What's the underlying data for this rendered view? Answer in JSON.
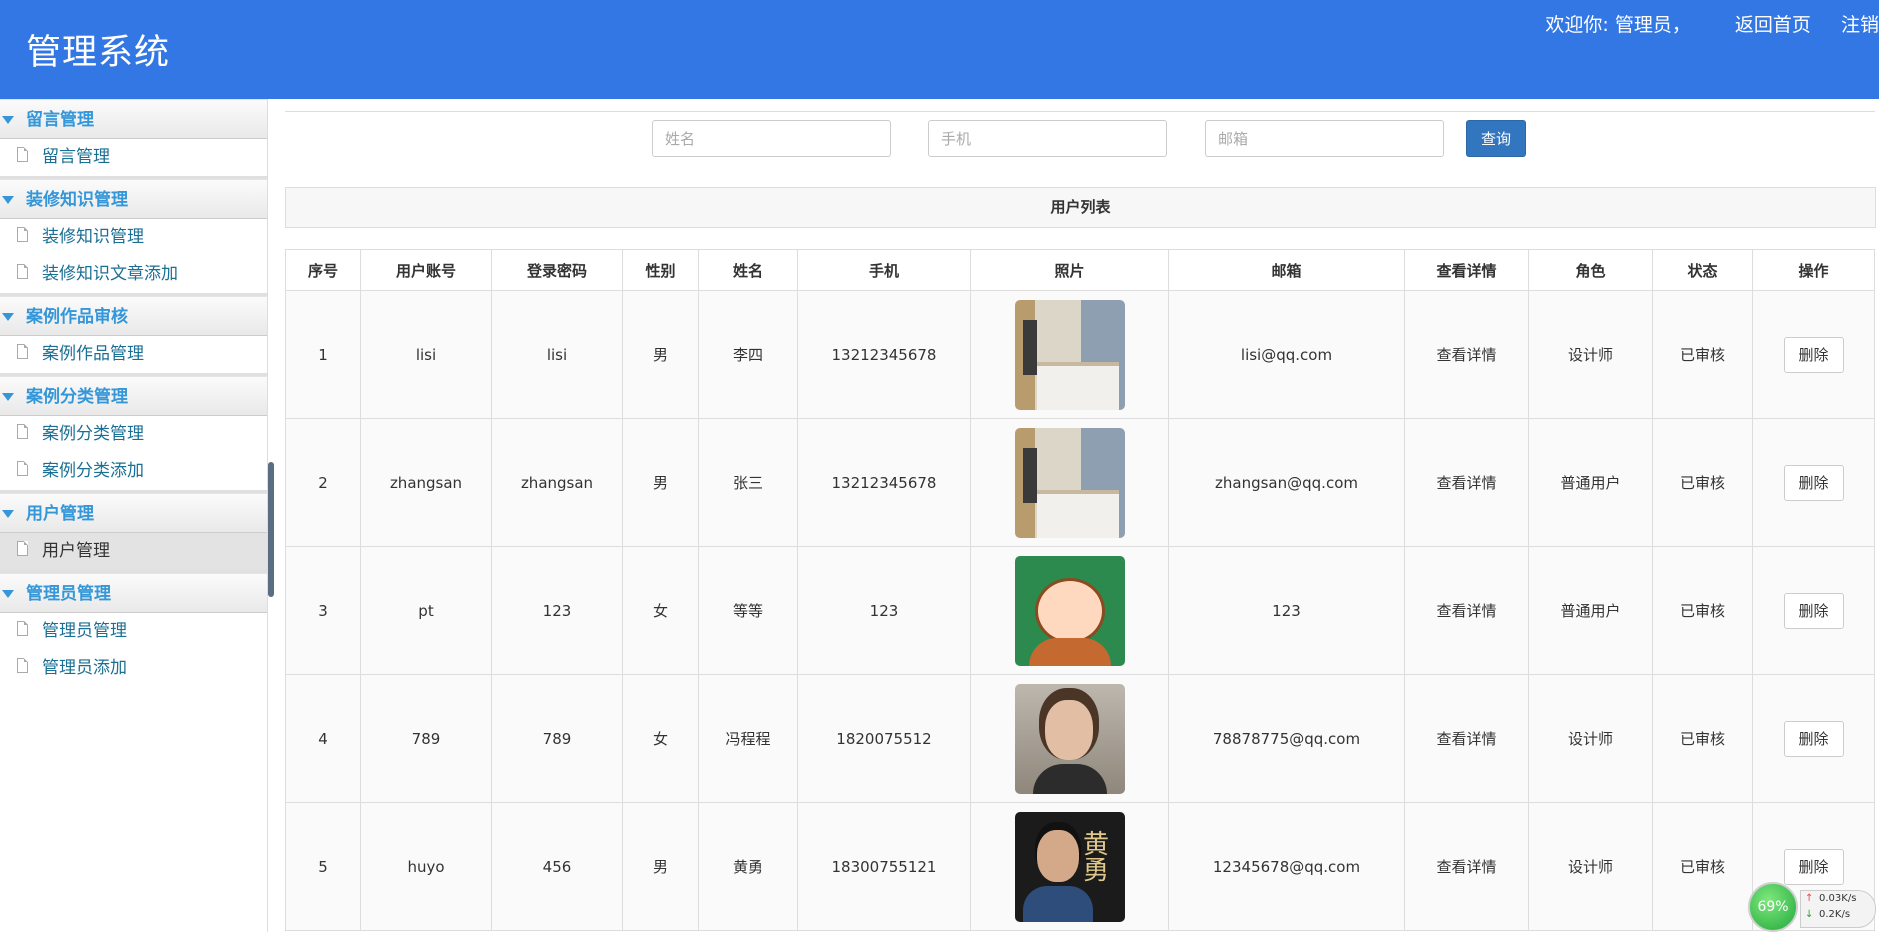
{
  "header": {
    "title": "管理系统",
    "welcome": "欢迎你: 管理员，",
    "home_link": "返回首页",
    "logout_link": "注销"
  },
  "sidebar": {
    "groups": [
      {
        "title": "留言管理",
        "items": [
          "留言管理"
        ]
      },
      {
        "title": "装修知识管理",
        "items": [
          "装修知识管理",
          "装修知识文章添加"
        ]
      },
      {
        "title": "案例作品审核",
        "items": [
          "案例作品管理"
        ]
      },
      {
        "title": "案例分类管理",
        "items": [
          "案例分类管理",
          "案例分类添加"
        ]
      },
      {
        "title": "用户管理",
        "items": [
          "用户管理"
        ]
      },
      {
        "title": "管理员管理",
        "items": [
          "管理员管理",
          "管理员添加"
        ]
      }
    ],
    "active_item": "用户管理"
  },
  "search": {
    "name_placeholder": "姓名",
    "phone_placeholder": "手机",
    "email_placeholder": "邮箱",
    "button_label": "查询"
  },
  "list_title": "用户列表",
  "table": {
    "columns": [
      "序号",
      "用户账号",
      "登录密码",
      "性别",
      "姓名",
      "手机",
      "照片",
      "邮箱",
      "查看详情",
      "角色",
      "状态",
      "操作"
    ],
    "rows": [
      {
        "no": "1",
        "account": "lisi",
        "password": "lisi",
        "gender": "男",
        "name": "李四",
        "phone": "13212345678",
        "photo": "room-photo",
        "email": "lisi@qq.com",
        "detail": "查看详情",
        "role": "设计师",
        "status": "已审核",
        "action": "删除"
      },
      {
        "no": "2",
        "account": "zhangsan",
        "password": "zhangsan",
        "gender": "男",
        "name": "张三",
        "phone": "13212345678",
        "photo": "room-photo",
        "email": "zhangsan@qq.com",
        "detail": "查看详情",
        "role": "普通用户",
        "status": "已审核",
        "action": "删除"
      },
      {
        "no": "3",
        "account": "pt",
        "password": "123",
        "gender": "女",
        "name": "等等",
        "phone": "123",
        "photo": "cartoon-girl-photo",
        "email": "123",
        "detail": "查看详情",
        "role": "普通用户",
        "status": "已审核",
        "action": "删除"
      },
      {
        "no": "4",
        "account": "789",
        "password": "789",
        "gender": "女",
        "name": "冯程程",
        "phone": "1820075512",
        "photo": "woman-portrait-photo",
        "email": "78878775@qq.com",
        "detail": "查看详情",
        "role": "设计师",
        "status": "已审核",
        "action": "删除"
      },
      {
        "no": "5",
        "account": "huyo",
        "password": "456",
        "gender": "男",
        "name": "黄勇",
        "phone": "18300755121",
        "photo": "man-portrait-photo",
        "email": "12345678@qq.com",
        "detail": "查看详情",
        "role": "设计师",
        "status": "已审核",
        "action": "删除"
      }
    ]
  },
  "net_widget": {
    "percent": "69%",
    "upload": "0.03K/s",
    "download": "0.2K/s"
  },
  "colors": {
    "header_bg": "#3377e4",
    "accent": "#3597d8",
    "button_primary": "#3376c0"
  }
}
